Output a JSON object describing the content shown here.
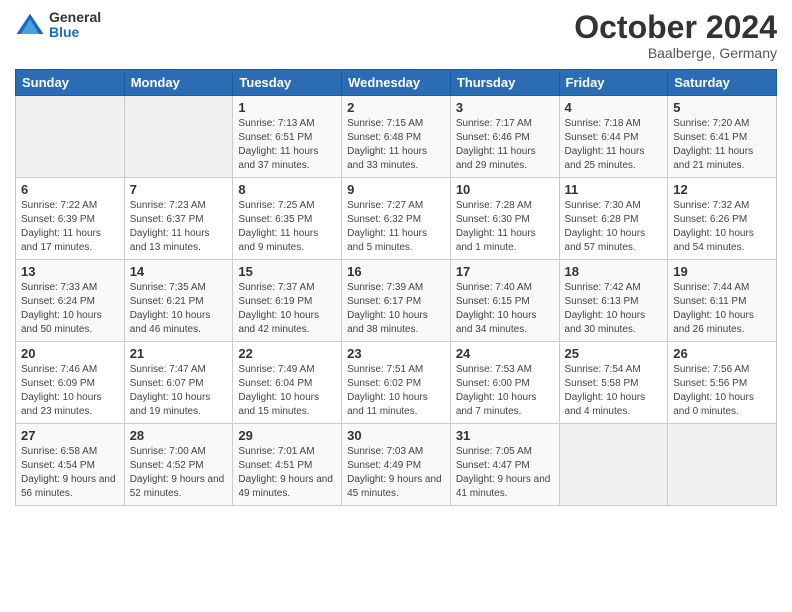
{
  "logo": {
    "general": "General",
    "blue": "Blue"
  },
  "header": {
    "month": "October 2024",
    "location": "Baalberge, Germany"
  },
  "weekdays": [
    "Sunday",
    "Monday",
    "Tuesday",
    "Wednesday",
    "Thursday",
    "Friday",
    "Saturday"
  ],
  "weeks": [
    [
      {
        "day": "",
        "info": ""
      },
      {
        "day": "",
        "info": ""
      },
      {
        "day": "1",
        "info": "Sunrise: 7:13 AM\nSunset: 6:51 PM\nDaylight: 11 hours and 37 minutes."
      },
      {
        "day": "2",
        "info": "Sunrise: 7:15 AM\nSunset: 6:48 PM\nDaylight: 11 hours and 33 minutes."
      },
      {
        "day": "3",
        "info": "Sunrise: 7:17 AM\nSunset: 6:46 PM\nDaylight: 11 hours and 29 minutes."
      },
      {
        "day": "4",
        "info": "Sunrise: 7:18 AM\nSunset: 6:44 PM\nDaylight: 11 hours and 25 minutes."
      },
      {
        "day": "5",
        "info": "Sunrise: 7:20 AM\nSunset: 6:41 PM\nDaylight: 11 hours and 21 minutes."
      }
    ],
    [
      {
        "day": "6",
        "info": "Sunrise: 7:22 AM\nSunset: 6:39 PM\nDaylight: 11 hours and 17 minutes."
      },
      {
        "day": "7",
        "info": "Sunrise: 7:23 AM\nSunset: 6:37 PM\nDaylight: 11 hours and 13 minutes."
      },
      {
        "day": "8",
        "info": "Sunrise: 7:25 AM\nSunset: 6:35 PM\nDaylight: 11 hours and 9 minutes."
      },
      {
        "day": "9",
        "info": "Sunrise: 7:27 AM\nSunset: 6:32 PM\nDaylight: 11 hours and 5 minutes."
      },
      {
        "day": "10",
        "info": "Sunrise: 7:28 AM\nSunset: 6:30 PM\nDaylight: 11 hours and 1 minute."
      },
      {
        "day": "11",
        "info": "Sunrise: 7:30 AM\nSunset: 6:28 PM\nDaylight: 10 hours and 57 minutes."
      },
      {
        "day": "12",
        "info": "Sunrise: 7:32 AM\nSunset: 6:26 PM\nDaylight: 10 hours and 54 minutes."
      }
    ],
    [
      {
        "day": "13",
        "info": "Sunrise: 7:33 AM\nSunset: 6:24 PM\nDaylight: 10 hours and 50 minutes."
      },
      {
        "day": "14",
        "info": "Sunrise: 7:35 AM\nSunset: 6:21 PM\nDaylight: 10 hours and 46 minutes."
      },
      {
        "day": "15",
        "info": "Sunrise: 7:37 AM\nSunset: 6:19 PM\nDaylight: 10 hours and 42 minutes."
      },
      {
        "day": "16",
        "info": "Sunrise: 7:39 AM\nSunset: 6:17 PM\nDaylight: 10 hours and 38 minutes."
      },
      {
        "day": "17",
        "info": "Sunrise: 7:40 AM\nSunset: 6:15 PM\nDaylight: 10 hours and 34 minutes."
      },
      {
        "day": "18",
        "info": "Sunrise: 7:42 AM\nSunset: 6:13 PM\nDaylight: 10 hours and 30 minutes."
      },
      {
        "day": "19",
        "info": "Sunrise: 7:44 AM\nSunset: 6:11 PM\nDaylight: 10 hours and 26 minutes."
      }
    ],
    [
      {
        "day": "20",
        "info": "Sunrise: 7:46 AM\nSunset: 6:09 PM\nDaylight: 10 hours and 23 minutes."
      },
      {
        "day": "21",
        "info": "Sunrise: 7:47 AM\nSunset: 6:07 PM\nDaylight: 10 hours and 19 minutes."
      },
      {
        "day": "22",
        "info": "Sunrise: 7:49 AM\nSunset: 6:04 PM\nDaylight: 10 hours and 15 minutes."
      },
      {
        "day": "23",
        "info": "Sunrise: 7:51 AM\nSunset: 6:02 PM\nDaylight: 10 hours and 11 minutes."
      },
      {
        "day": "24",
        "info": "Sunrise: 7:53 AM\nSunset: 6:00 PM\nDaylight: 10 hours and 7 minutes."
      },
      {
        "day": "25",
        "info": "Sunrise: 7:54 AM\nSunset: 5:58 PM\nDaylight: 10 hours and 4 minutes."
      },
      {
        "day": "26",
        "info": "Sunrise: 7:56 AM\nSunset: 5:56 PM\nDaylight: 10 hours and 0 minutes."
      }
    ],
    [
      {
        "day": "27",
        "info": "Sunrise: 6:58 AM\nSunset: 4:54 PM\nDaylight: 9 hours and 56 minutes."
      },
      {
        "day": "28",
        "info": "Sunrise: 7:00 AM\nSunset: 4:52 PM\nDaylight: 9 hours and 52 minutes."
      },
      {
        "day": "29",
        "info": "Sunrise: 7:01 AM\nSunset: 4:51 PM\nDaylight: 9 hours and 49 minutes."
      },
      {
        "day": "30",
        "info": "Sunrise: 7:03 AM\nSunset: 4:49 PM\nDaylight: 9 hours and 45 minutes."
      },
      {
        "day": "31",
        "info": "Sunrise: 7:05 AM\nSunset: 4:47 PM\nDaylight: 9 hours and 41 minutes."
      },
      {
        "day": "",
        "info": ""
      },
      {
        "day": "",
        "info": ""
      }
    ]
  ]
}
